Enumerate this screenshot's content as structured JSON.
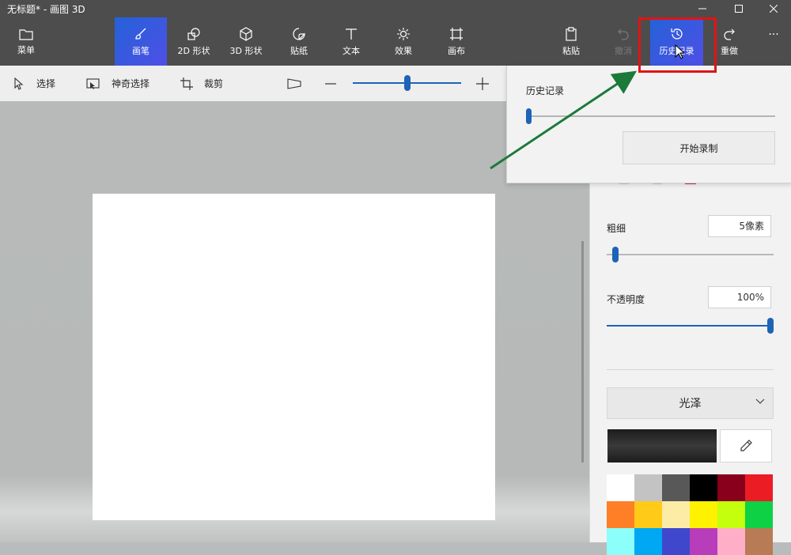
{
  "window": {
    "title": "无标题* - 画图 3D"
  },
  "toolbar": {
    "menu": "菜单",
    "brush": "画笔",
    "shapes2d": "2D 形状",
    "shapes3d": "3D 形状",
    "stickers": "贴纸",
    "text": "文本",
    "effects": "效果",
    "canvas": "画布",
    "paste": "粘贴",
    "undo": "撤消",
    "history": "历史记录",
    "redo": "重做",
    "more": "···"
  },
  "subbar": {
    "select": "选择",
    "magic_select": "神奇选择",
    "crop": "裁剪",
    "zoom_level": 0.5
  },
  "history_panel": {
    "title": "历史记录",
    "start_recording": "开始录制"
  },
  "brush_panel": {
    "thickness_label": "粗细",
    "thickness_value": "5像素",
    "opacity_label": "不透明度",
    "opacity_value": "100%",
    "finish_dropdown": "光泽"
  },
  "colors": {
    "accent": "#2462d8",
    "highlight_red": "#e31313",
    "arrow_green": "#1b7a3a",
    "current_color": "#2b2b2b",
    "palette": [
      "#ffffff",
      "#c3c3c3",
      "#585858",
      "#000000",
      "#88001b",
      "#ec1c24",
      "#ff7f27",
      "#ffca18",
      "#fdeca6",
      "#fff200",
      "#c4ff0e",
      "#0ed145",
      "#8cfffb",
      "#00a8f3",
      "#3f48cc",
      "#b83dba",
      "#ffaec8",
      "#b97a56"
    ]
  }
}
